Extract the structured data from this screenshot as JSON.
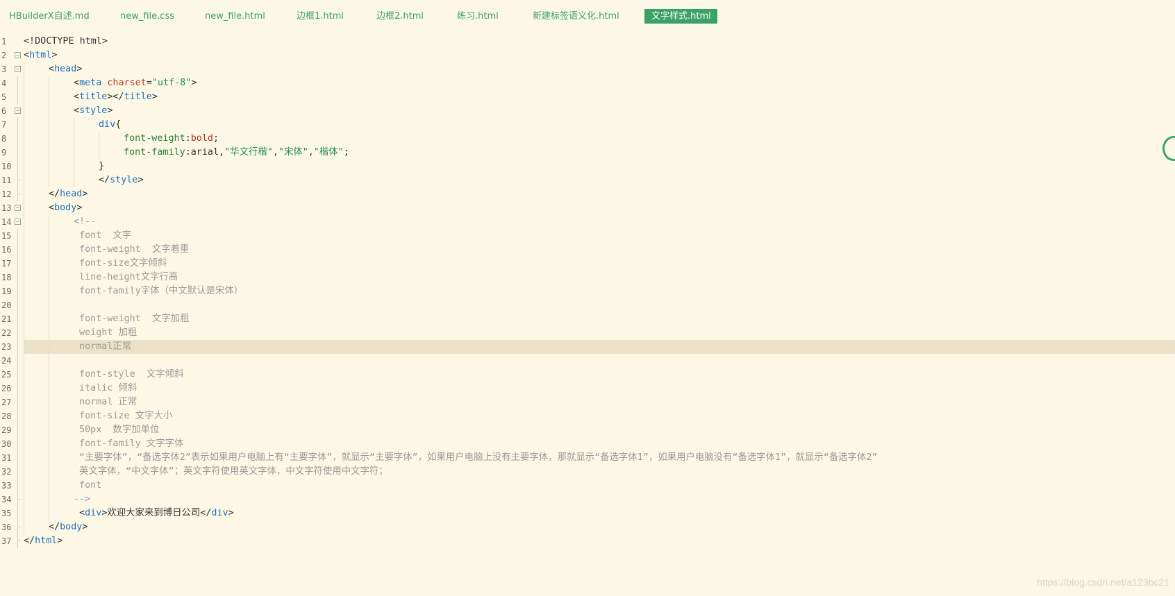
{
  "tabs": [
    {
      "label": "HBuilderX自述.md",
      "active": false
    },
    {
      "label": "new_file.css",
      "active": false
    },
    {
      "label": "new_file.html",
      "active": false
    },
    {
      "label": "边框1.html",
      "active": false
    },
    {
      "label": "边框2.html",
      "active": false
    },
    {
      "label": "练习.html",
      "active": false
    },
    {
      "label": "新建标签语义化.html",
      "active": false
    },
    {
      "label": "文字样式.html",
      "active": true
    }
  ],
  "editor": {
    "current_line": 23,
    "lines": [
      {
        "n": "1",
        "fold": "",
        "indent": 0,
        "tokens": [
          [
            "pl",
            "<!DOCTYPE html>"
          ]
        ]
      },
      {
        "n": "2",
        "fold": "open",
        "indent": 0,
        "tokens": [
          [
            "br",
            "<"
          ],
          [
            "tag",
            "html"
          ],
          [
            "br",
            ">"
          ]
        ]
      },
      {
        "n": "3",
        "fold": "open",
        "indent": 1,
        "tokens": [
          [
            "br",
            "<"
          ],
          [
            "tag",
            "head"
          ],
          [
            "br",
            ">"
          ]
        ]
      },
      {
        "n": "4",
        "fold": "",
        "indent": 2,
        "tokens": [
          [
            "br",
            "<"
          ],
          [
            "tag",
            "meta"
          ],
          [
            "pl",
            " "
          ],
          [
            "attr",
            "charset"
          ],
          [
            "pl",
            "="
          ],
          [
            "str",
            "\"utf-8\""
          ],
          [
            "br",
            ">"
          ]
        ]
      },
      {
        "n": "5",
        "fold": "",
        "indent": 2,
        "tokens": [
          [
            "br",
            "<"
          ],
          [
            "tag",
            "title"
          ],
          [
            "br",
            "></"
          ],
          [
            "tag",
            "title"
          ],
          [
            "br",
            ">"
          ]
        ]
      },
      {
        "n": "6",
        "fold": "open",
        "indent": 2,
        "tokens": [
          [
            "br",
            "<"
          ],
          [
            "tag",
            "style"
          ],
          [
            "br",
            ">"
          ]
        ]
      },
      {
        "n": "7",
        "fold": "",
        "indent": 3,
        "tokens": [
          [
            "sel",
            "div"
          ],
          [
            "pl",
            "{"
          ]
        ]
      },
      {
        "n": "8",
        "fold": "",
        "indent": 4,
        "tokens": [
          [
            "prop",
            "font-weight"
          ],
          [
            "pl",
            ":"
          ],
          [
            "val",
            "bold"
          ],
          [
            "pl",
            ";"
          ]
        ]
      },
      {
        "n": "9",
        "fold": "",
        "indent": 4,
        "tokens": [
          [
            "prop",
            "font-family"
          ],
          [
            "pl",
            ":arial,"
          ],
          [
            "str",
            "\"华文行楷\""
          ],
          [
            "pl",
            ","
          ],
          [
            "str",
            "\"宋体\""
          ],
          [
            "pl",
            ","
          ],
          [
            "str",
            "\"楷体\""
          ],
          [
            "pl",
            ";"
          ]
        ]
      },
      {
        "n": "10",
        "fold": "",
        "indent": 3,
        "tokens": [
          [
            "pl",
            "}"
          ]
        ]
      },
      {
        "n": "11",
        "fold": "end",
        "indent": 3,
        "tokens": [
          [
            "br",
            "</"
          ],
          [
            "tag",
            "style"
          ],
          [
            "br",
            ">"
          ]
        ]
      },
      {
        "n": "12",
        "fold": "end",
        "indent": 1,
        "tokens": [
          [
            "br",
            "</"
          ],
          [
            "tag",
            "head"
          ],
          [
            "br",
            ">"
          ]
        ]
      },
      {
        "n": "13",
        "fold": "open",
        "indent": 1,
        "tokens": [
          [
            "br",
            "<"
          ],
          [
            "tag",
            "body"
          ],
          [
            "br",
            ">"
          ]
        ]
      },
      {
        "n": "14",
        "fold": "open",
        "indent": 2,
        "tokens": [
          [
            "com",
            "<!--"
          ]
        ]
      },
      {
        "n": "15",
        "fold": "",
        "indent": 2,
        "tokens": [
          [
            "com",
            " font  文字"
          ]
        ]
      },
      {
        "n": "16",
        "fold": "",
        "indent": 2,
        "tokens": [
          [
            "com",
            " font-weight  文字着重"
          ]
        ]
      },
      {
        "n": "17",
        "fold": "",
        "indent": 2,
        "tokens": [
          [
            "com",
            " font-size文字倾斜"
          ]
        ]
      },
      {
        "n": "18",
        "fold": "",
        "indent": 2,
        "tokens": [
          [
            "com",
            " line-height文字行高"
          ]
        ]
      },
      {
        "n": "19",
        "fold": "",
        "indent": 2,
        "tokens": [
          [
            "com",
            " font-family字体（中文默认是宋体）"
          ]
        ]
      },
      {
        "n": "20",
        "fold": "",
        "indent": 2,
        "tokens": [
          [
            "com",
            ""
          ]
        ]
      },
      {
        "n": "21",
        "fold": "",
        "indent": 2,
        "tokens": [
          [
            "com",
            " font-weight  文字加粗"
          ]
        ]
      },
      {
        "n": "22",
        "fold": "",
        "indent": 2,
        "tokens": [
          [
            "com",
            " weight 加粗"
          ]
        ]
      },
      {
        "n": "23",
        "fold": "",
        "indent": 2,
        "tokens": [
          [
            "com",
            " normal正常"
          ]
        ]
      },
      {
        "n": "24",
        "fold": "",
        "indent": 2,
        "tokens": [
          [
            "com",
            ""
          ]
        ]
      },
      {
        "n": "25",
        "fold": "",
        "indent": 2,
        "tokens": [
          [
            "com",
            " font-style  文字倾斜"
          ]
        ]
      },
      {
        "n": "26",
        "fold": "",
        "indent": 2,
        "tokens": [
          [
            "com",
            " italic 倾斜"
          ]
        ]
      },
      {
        "n": "27",
        "fold": "",
        "indent": 2,
        "tokens": [
          [
            "com",
            " normal 正常"
          ]
        ]
      },
      {
        "n": "28",
        "fold": "",
        "indent": 2,
        "tokens": [
          [
            "com",
            " font-size 文字大小"
          ]
        ]
      },
      {
        "n": "29",
        "fold": "",
        "indent": 2,
        "tokens": [
          [
            "com",
            " 50px  数字加单位"
          ]
        ]
      },
      {
        "n": "30",
        "fold": "",
        "indent": 2,
        "tokens": [
          [
            "com",
            " font-family 文字字体"
          ]
        ]
      },
      {
        "n": "31",
        "fold": "",
        "indent": 2,
        "tokens": [
          [
            "com",
            " “主要字体”，“备选字体2”表示如果用户电脑上有“主要字体”，就显示“主要字体”，如果用户电脑上没有主要字体，那就显示“备选字体1”，如果用户电脑没有“备选字体1”，就显示“备选字体2”"
          ]
        ]
      },
      {
        "n": "32",
        "fold": "",
        "indent": 2,
        "tokens": [
          [
            "com",
            " 英文字体，“中文字体”；英文字符使用英文字体，中文字符使用中文字符；"
          ]
        ]
      },
      {
        "n": "33",
        "fold": "",
        "indent": 2,
        "tokens": [
          [
            "com",
            " font"
          ]
        ]
      },
      {
        "n": "34",
        "fold": "end",
        "indent": 2,
        "tokens": [
          [
            "com",
            "-->"
          ]
        ]
      },
      {
        "n": "35",
        "fold": "",
        "indent": 2,
        "tokens": [
          [
            "pl",
            " "
          ],
          [
            "br",
            "<"
          ],
          [
            "tag",
            "div"
          ],
          [
            "br",
            ">"
          ],
          [
            "pl",
            "欢迎大家来到博日公司"
          ],
          [
            "br",
            "</"
          ],
          [
            "tag",
            "div"
          ],
          [
            "br",
            ">"
          ]
        ]
      },
      {
        "n": "36",
        "fold": "end",
        "indent": 1,
        "tokens": [
          [
            "br",
            "</"
          ],
          [
            "tag",
            "body"
          ],
          [
            "br",
            ">"
          ]
        ]
      },
      {
        "n": "37",
        "fold": "end",
        "indent": 0,
        "tokens": [
          [
            "br",
            "</"
          ],
          [
            "tag",
            "html"
          ],
          [
            "br",
            ">"
          ]
        ]
      }
    ]
  },
  "watermark": "https://blog.csdn.net/a123bc21",
  "colors": {
    "accent": "#3aa262",
    "background": "#fdf8e6",
    "current_line": "#ece3c6"
  }
}
